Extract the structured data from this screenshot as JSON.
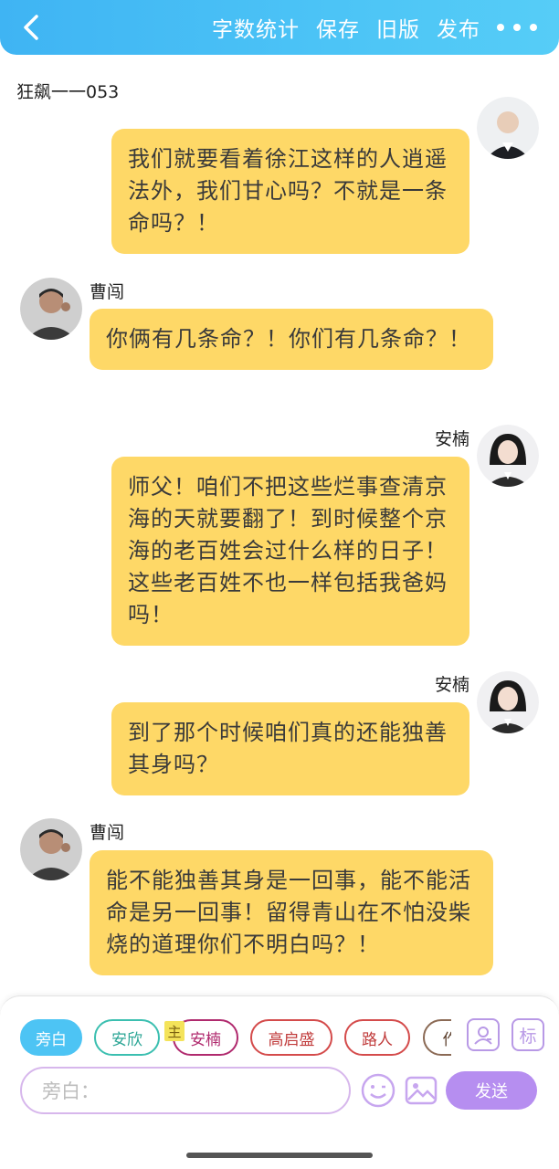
{
  "topbar": {
    "actions": [
      "字数统计",
      "保存",
      "旧版",
      "发布"
    ]
  },
  "doc_title": "狂飙一一053",
  "messages": [
    {
      "speaker": "",
      "text": "我们就要看着徐江这样的人逍遥法外，我们甘心吗？不就是一条命吗？！"
    },
    {
      "speaker": "曹闯",
      "text": "你俩有几条命？！你们有几条命？！"
    },
    {
      "speaker": "安楠",
      "text": "师父！咱们不把这些烂事查清京海的天就要翻了！到时候整个京海的老百姓会过什么样的日子！这些老百姓不也一样包括我爸妈吗！"
    },
    {
      "speaker": "安楠",
      "text": "到了那个时候咱们真的还能独善其身吗？"
    },
    {
      "speaker": "曹闯",
      "text": "能不能独善其身是一回事，能不能活命是另一回事！留得青山在不怕没柴烧的道理你们不明白吗？！"
    }
  ],
  "roles": [
    "旁白",
    "安欣",
    "安楠",
    "高启盛",
    "路人",
    "作"
  ],
  "main_tag": "主",
  "tools": {
    "role_card": "",
    "mark": "标"
  },
  "input": {
    "placeholder": "旁白："
  },
  "send_label": "发送",
  "colors": {
    "topbar": "#4cc4f6",
    "bubble": "#fed867",
    "narration_chip": "#4dc4f4",
    "anxin_chip": "#3bbfb0",
    "annan_chip": "#b02a6e",
    "gaoqisheng_chip": "#d44b4b",
    "luren_chip": "#d44b4b",
    "send": "#b68ef0"
  }
}
